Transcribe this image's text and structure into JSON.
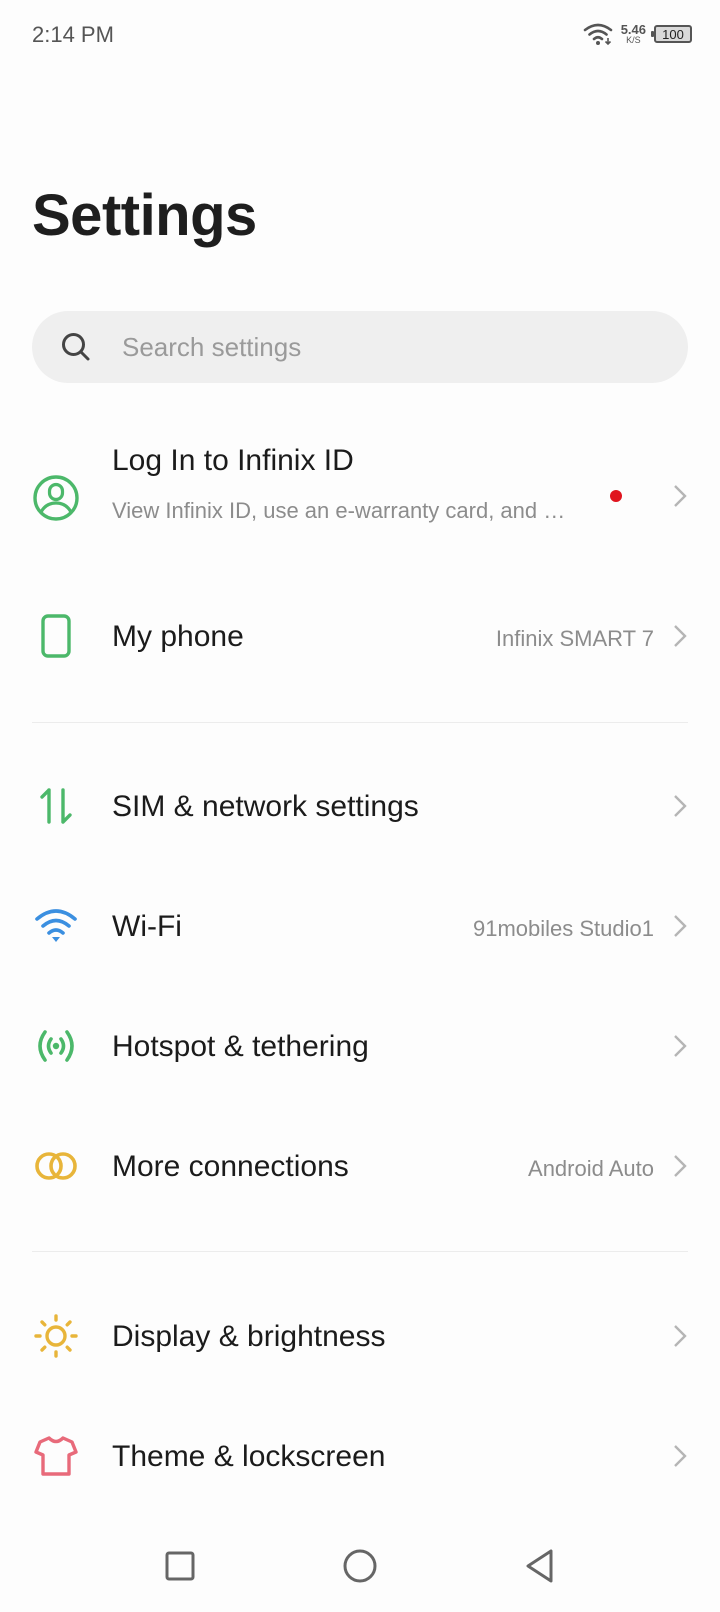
{
  "status_bar": {
    "time": "2:14 PM",
    "net_speed_value": "5.46",
    "net_speed_unit": "K/S",
    "battery": "100"
  },
  "header": {
    "title": "Settings"
  },
  "search": {
    "placeholder": "Search settings"
  },
  "account": {
    "title": "Log In to Infinix ID",
    "subtitle": "View Infinix ID, use an e-warranty card, and …",
    "icon": "account-circle-icon",
    "icon_color": "#4cb86a",
    "badge_color": "#e0141e"
  },
  "items": [
    {
      "label": "My phone",
      "value": "Infinix SMART 7",
      "icon": "phone-icon",
      "color": "#4cb86a"
    },
    {
      "label": "SIM & network settings",
      "value": "",
      "icon": "sim-network-icon",
      "color": "#4cb86a"
    },
    {
      "label": "Wi-Fi",
      "value": "91mobiles Studio1",
      "icon": "wifi-icon",
      "color": "#3b8fe0"
    },
    {
      "label": "Hotspot & tethering",
      "value": "",
      "icon": "hotspot-icon",
      "color": "#4cb86a"
    },
    {
      "label": "More connections",
      "value": "Android Auto",
      "icon": "link-rings-icon",
      "color": "#e8b53a"
    },
    {
      "label": "Display & brightness",
      "value": "",
      "icon": "sun-icon",
      "color": "#e8b53a"
    },
    {
      "label": "Theme & lockscreen",
      "value": "",
      "icon": "tshirt-icon",
      "color": "#e86a7a"
    }
  ],
  "nav": {
    "recents": "square-icon",
    "home": "circle-icon",
    "back": "triangle-back-icon"
  }
}
